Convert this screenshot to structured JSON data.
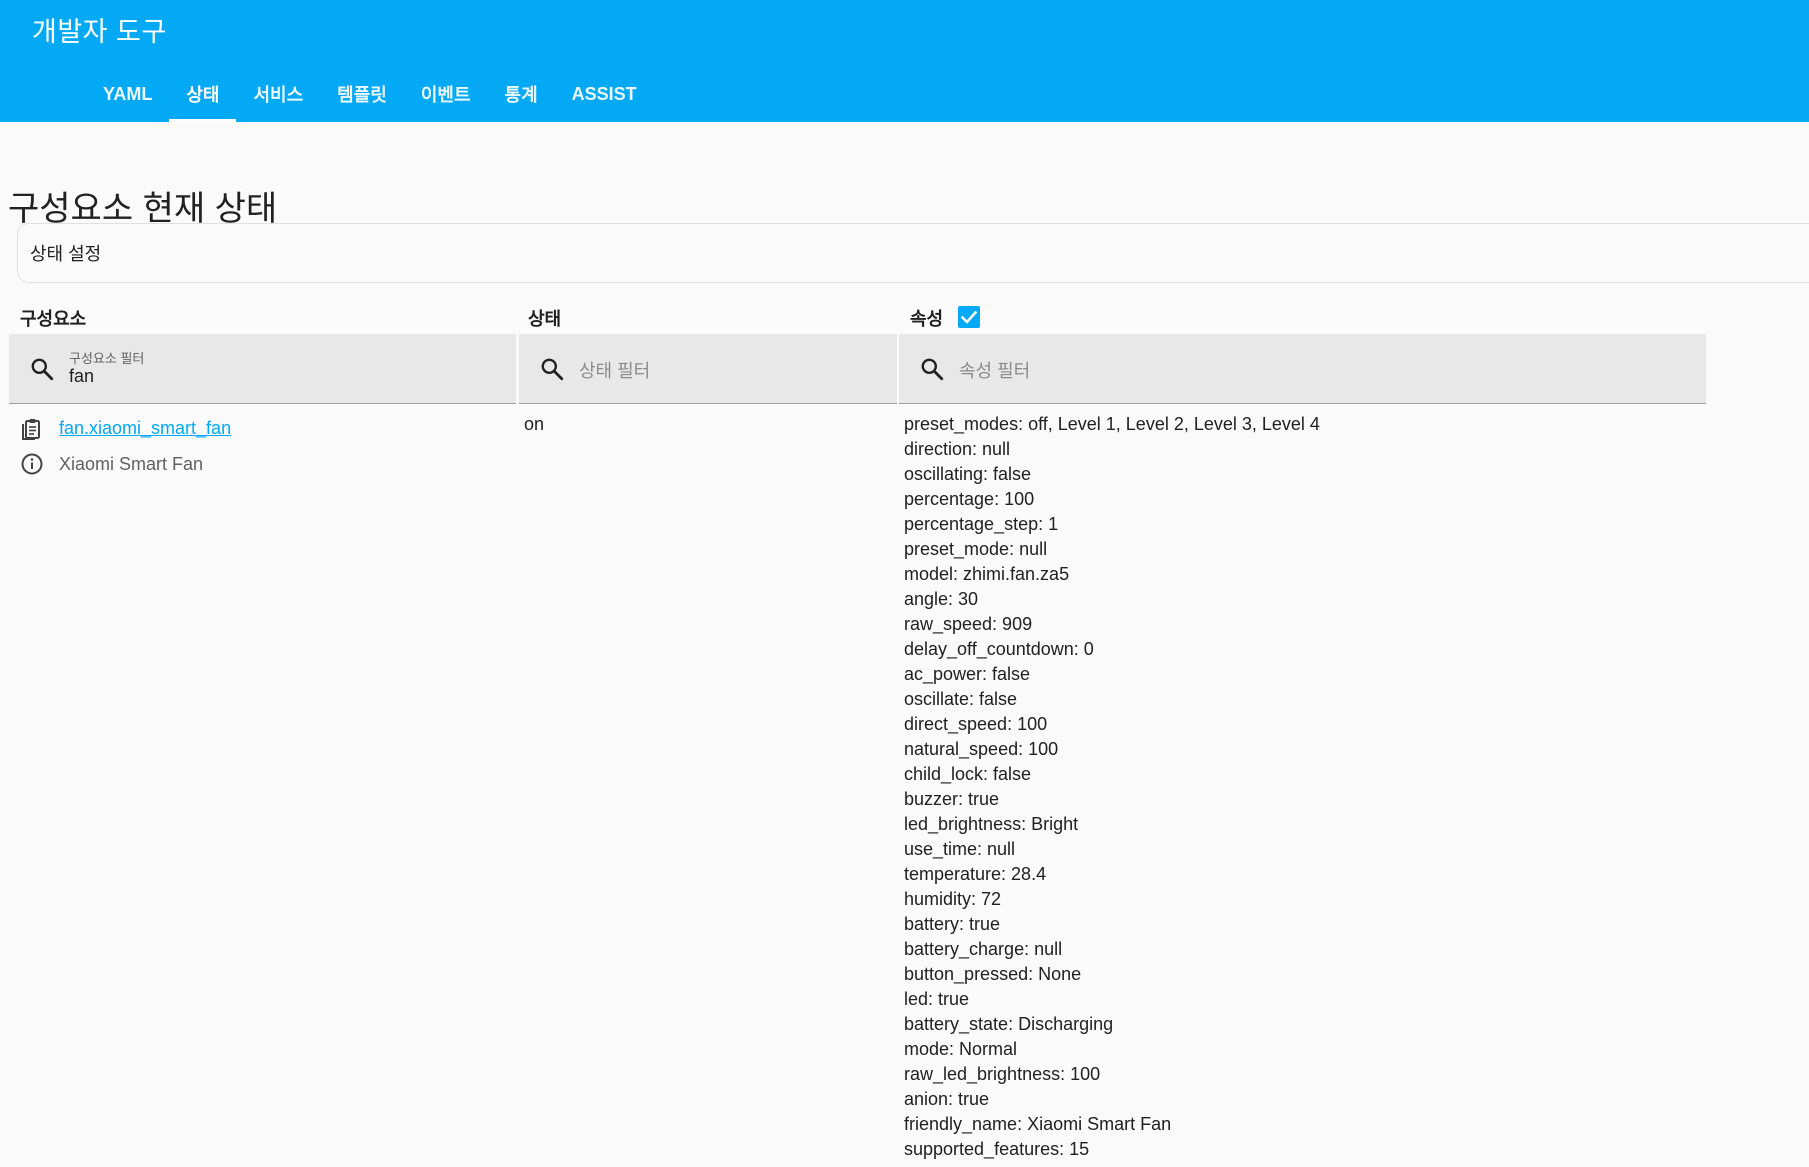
{
  "app": {
    "title": "개발자 도구"
  },
  "tabs": [
    {
      "label": "YAML",
      "active": false
    },
    {
      "label": "상태",
      "active": true
    },
    {
      "label": "서비스",
      "active": false
    },
    {
      "label": "템플릿",
      "active": false
    },
    {
      "label": "이벤트",
      "active": false
    },
    {
      "label": "통계",
      "active": false
    },
    {
      "label": "ASSIST",
      "active": false
    }
  ],
  "page": {
    "title": "구성요소 현재 상태",
    "set_state_label": "상태 설정"
  },
  "columns": {
    "entity": "구성요소",
    "state": "상태",
    "attributes": "속성",
    "attributes_checked": true
  },
  "filters": {
    "entity": {
      "label": "구성요소 필터",
      "value": "fan"
    },
    "state": {
      "placeholder": "상태 필터"
    },
    "attributes": {
      "placeholder": "속성 필터"
    }
  },
  "entity": {
    "id": "fan.xiaomi_smart_fan",
    "friendly_name": "Xiaomi Smart Fan",
    "state": "on",
    "attributes": [
      "preset_modes: off, Level 1, Level 2, Level 3, Level 4",
      "direction: null",
      "oscillating: false",
      "percentage: 100",
      "percentage_step: 1",
      "preset_mode: null",
      "model: zhimi.fan.za5",
      "angle: 30",
      "raw_speed: 909",
      "delay_off_countdown: 0",
      "ac_power: false",
      "oscillate: false",
      "direct_speed: 100",
      "natural_speed: 100",
      "child_lock: false",
      "buzzer: true",
      "led_brightness: Bright",
      "use_time: null",
      "temperature: 28.4",
      "humidity: 72",
      "battery: true",
      "battery_charge: null",
      "button_pressed: None",
      "led: true",
      "battery_state: Discharging",
      "mode: Normal",
      "raw_led_brightness: 100",
      "anion: true",
      "friendly_name: Xiaomi Smart Fan",
      "supported_features: 15"
    ]
  },
  "colors": {
    "primary": "#03a9f4",
    "background": "#fafafa",
    "filter_bg": "#e8e8e8"
  }
}
